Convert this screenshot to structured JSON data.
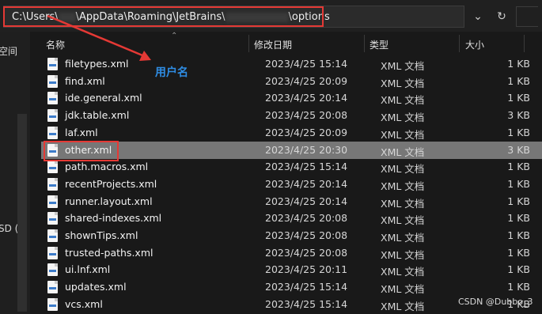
{
  "address": {
    "seg1": "C:\\Users\\",
    "seg2": "\\AppData\\Roaming\\JetBrains\\",
    "seg3": "\\options"
  },
  "nav": {
    "label1": "空间",
    "label2": "SD ("
  },
  "columns": {
    "name": "名称",
    "date": "修改日期",
    "type": "类型",
    "size": "大小"
  },
  "files": [
    {
      "name": "filetypes.xml",
      "date": "2023/4/25 15:14",
      "type": "XML 文档",
      "size": "1 KB"
    },
    {
      "name": "find.xml",
      "date": "2023/4/25 20:09",
      "type": "XML 文档",
      "size": "1 KB"
    },
    {
      "name": "ide.general.xml",
      "date": "2023/4/25 20:14",
      "type": "XML 文档",
      "size": "1 KB"
    },
    {
      "name": "jdk.table.xml",
      "date": "2023/4/25 20:08",
      "type": "XML 文档",
      "size": "3 KB"
    },
    {
      "name": "laf.xml",
      "date": "2023/4/25 20:09",
      "type": "XML 文档",
      "size": "1 KB"
    },
    {
      "name": "other.xml",
      "date": "2023/4/25 20:30",
      "type": "XML 文档",
      "size": "3 KB",
      "selected": true
    },
    {
      "name": "path.macros.xml",
      "date": "2023/4/25 15:14",
      "type": "XML 文档",
      "size": "1 KB"
    },
    {
      "name": "recentProjects.xml",
      "date": "2023/4/25 20:14",
      "type": "XML 文档",
      "size": "1 KB"
    },
    {
      "name": "runner.layout.xml",
      "date": "2023/4/25 20:14",
      "type": "XML 文档",
      "size": "1 KB"
    },
    {
      "name": "shared-indexes.xml",
      "date": "2023/4/25 20:08",
      "type": "XML 文档",
      "size": "1 KB"
    },
    {
      "name": "shownTips.xml",
      "date": "2023/4/25 20:08",
      "type": "XML 文档",
      "size": "1 KB"
    },
    {
      "name": "trusted-paths.xml",
      "date": "2023/4/25 20:08",
      "type": "XML 文档",
      "size": "1 KB"
    },
    {
      "name": "ui.lnf.xml",
      "date": "2023/4/25 20:11",
      "type": "XML 文档",
      "size": "1 KB"
    },
    {
      "name": "updates.xml",
      "date": "2023/4/25 15:14",
      "type": "XML 文档",
      "size": "1 KB"
    },
    {
      "name": "vcs.xml",
      "date": "2023/4/25 15:14",
      "type": "XML 文档",
      "size": "1 KB"
    }
  ],
  "annotation": "用户名",
  "watermark": "CSDN @Dubbo_3",
  "colors": {
    "highlight": "#e53935",
    "annotation": "#2f8de4",
    "selected": "#777777"
  },
  "icons": {
    "dropdown": "chevron-down-icon",
    "refresh": "refresh-icon",
    "file": "xml-file-icon"
  }
}
